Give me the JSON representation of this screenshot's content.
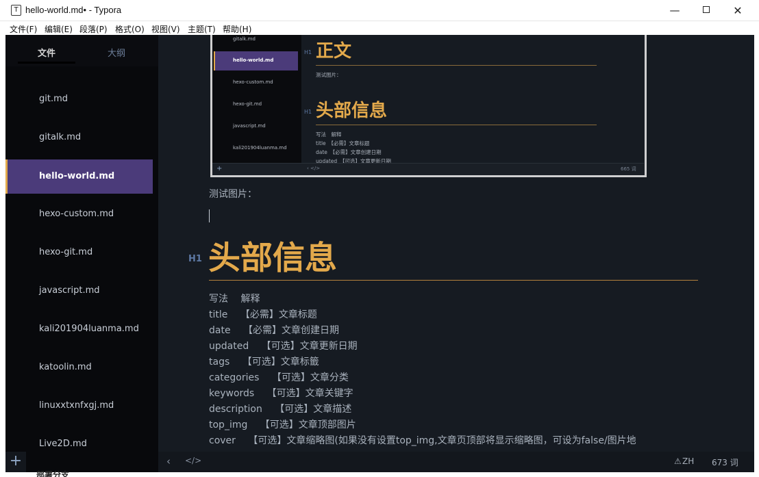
{
  "window": {
    "icon_letter": "T",
    "title": "hello-world.md• - Typora",
    "minimize": "—",
    "close": "✕"
  },
  "menu": [
    "文件(F)",
    "编辑(E)",
    "段落(P)",
    "格式(O)",
    "视图(V)",
    "主题(T)",
    "帮助(H)"
  ],
  "sidebar": {
    "tabs": [
      "文件",
      "大纲"
    ],
    "files": [
      "git.md",
      "gitalk.md",
      "hello-world.md",
      "hexo-custom.md",
      "hexo-git.md",
      "javascript.md",
      "kali201904luanma.md",
      "katoolin.md",
      "linuxxtxnfxgj.md",
      "Live2D.md"
    ],
    "active_file": "hello-world.md"
  },
  "embedded_image": {
    "files": [
      "gitalk.md",
      "hello-world.md",
      "hexo-custom.md",
      "hexo-git.md",
      "javascript.md",
      "kali201904luanma.md"
    ],
    "h1_marker": "H1",
    "heading1": "正文",
    "text1": "测试图片：",
    "heading2": "头部信息",
    "rows": [
      "写法　解释",
      "title　【必需】文章标题",
      "date　【必需】文章创建日期",
      "updated　【可选】文章更新日期"
    ],
    "bottom_left": "+",
    "bottom_nav": "‹   </>",
    "word_count": "665 词"
  },
  "document": {
    "caption": "测试图片：",
    "h1_marker": "H1",
    "heading": "头部信息",
    "rows": [
      "写法　 解释",
      "title　 【必需】文章标题",
      "date　 【必需】文章创建日期",
      "updated　 【可选】文章更新日期",
      "tags　 【可选】文章标籤",
      "categories　 【可选】文章分类",
      "keywords　 【可选】文章关键字",
      "description　 【可选】文章描述",
      "top_img　 【可选】文章顶部图片",
      "cover　 【可选】文章缩略图(如果没有设置top_img,文章页顶部将显示缩略图，可设为false/图片地"
    ]
  },
  "statusbar": {
    "add": "+",
    "back": "‹",
    "source": "</>",
    "warning": "⚠",
    "language": "ZH",
    "word_count": "673 词"
  },
  "outside_text": "部署分支"
}
